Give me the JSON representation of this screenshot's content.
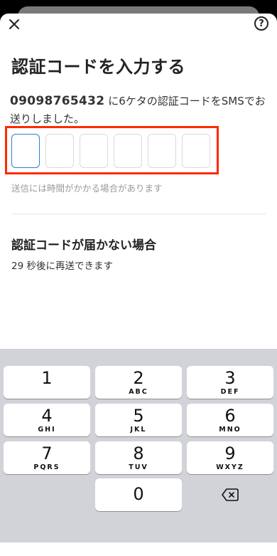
{
  "header": {
    "close_icon": "close-icon",
    "help_icon": "help-icon",
    "help_glyph": "?"
  },
  "title": "認証コードを入力する",
  "description": {
    "phone": "09098765432",
    "text": " に6ケタの認証コードをSMSでお送りしました。"
  },
  "code_input": {
    "digits": [
      "",
      "",
      "",
      "",
      "",
      ""
    ],
    "active_index": 0,
    "active_color": "#2f7fd6",
    "highlight_color": "#ff2a00"
  },
  "hint": "送信には時間がかかる場合があります",
  "not_received": {
    "heading": "認証コードが届かない場合",
    "resend_text": "29 秒後に再送できます"
  },
  "keypad": {
    "keys": [
      {
        "num": "1",
        "letters": ""
      },
      {
        "num": "2",
        "letters": "ABC"
      },
      {
        "num": "3",
        "letters": "DEF"
      },
      {
        "num": "4",
        "letters": "GHI"
      },
      {
        "num": "5",
        "letters": "JKL"
      },
      {
        "num": "6",
        "letters": "MNO"
      },
      {
        "num": "7",
        "letters": "PQRS"
      },
      {
        "num": "8",
        "letters": "TUV"
      },
      {
        "num": "9",
        "letters": "WXYZ"
      },
      {
        "num": "0",
        "letters": ""
      }
    ],
    "delete_icon": "backspace-icon"
  }
}
